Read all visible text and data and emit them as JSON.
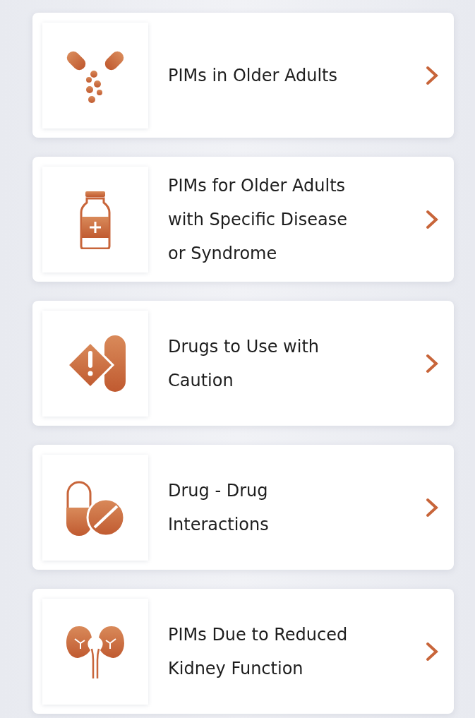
{
  "menu_items": [
    {
      "kind": "pills",
      "title_lines": [
        "PIMs in Older Adults"
      ]
    },
    {
      "kind": "bottle",
      "title_lines": [
        "PIMs for Older Adults",
        "with Specific Disease",
        "or Syndrome"
      ]
    },
    {
      "kind": "caution",
      "title_lines": [
        "Drugs to Use with",
        "Caution"
      ]
    },
    {
      "kind": "interaction",
      "title_lines": [
        "Drug - Drug",
        "Interactions"
      ]
    },
    {
      "kind": "kidney",
      "title_lines": [
        "PIMs Due to Reduced",
        "Kidney Function"
      ]
    }
  ]
}
